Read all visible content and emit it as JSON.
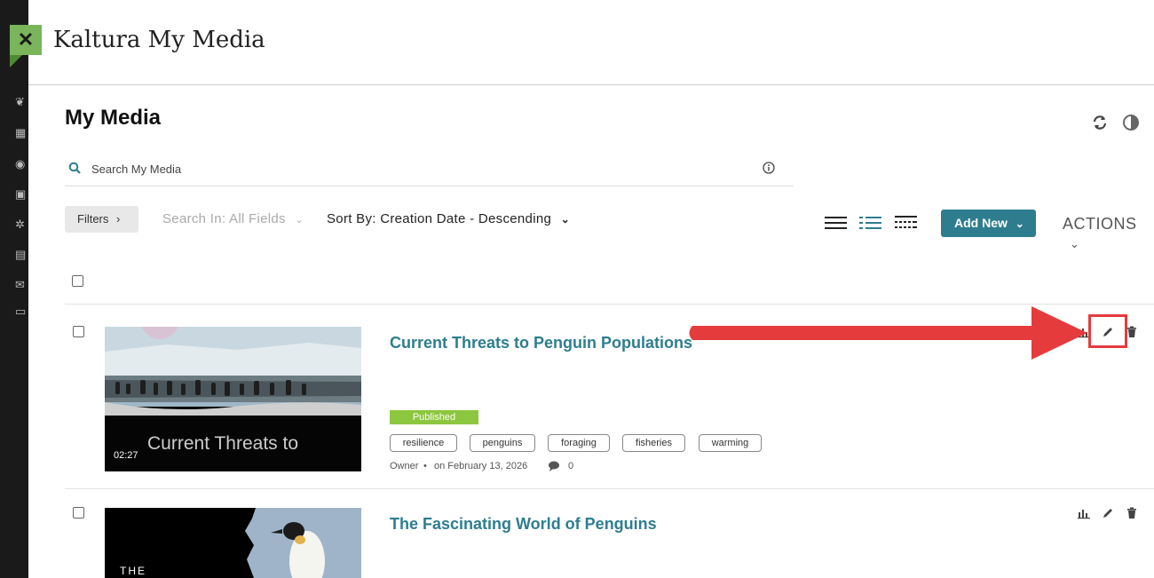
{
  "app": {
    "title": "Kaltura My Media",
    "close_icon": "close-icon"
  },
  "page": {
    "title": "My Media"
  },
  "search": {
    "placeholder": "Search My Media"
  },
  "toolbar": {
    "filters_label": "Filters",
    "search_in_label": "Search In: All Fields",
    "sort_by_label": "Sort By: Creation Date - Descending",
    "add_new_label": "Add New",
    "actions_label": "ACTIONS"
  },
  "entries": [
    {
      "title": "Current Threats to Penguin Populations",
      "duration": "02:27",
      "thumb_caption": "Current Threats to",
      "status": "Published",
      "tags": [
        "resilience",
        "penguins",
        "foraging",
        "fisheries",
        "warming"
      ],
      "owner_label": "Owner",
      "date": "on February 13, 2026",
      "comments": "0"
    },
    {
      "title": "The Fascinating World of Penguins",
      "thumb_caption": "THE"
    }
  ],
  "colors": {
    "accent": "#2e7d8f",
    "published": "#8dc63f",
    "highlight": "#e53b3d",
    "close_tab": "#7ab55c"
  }
}
